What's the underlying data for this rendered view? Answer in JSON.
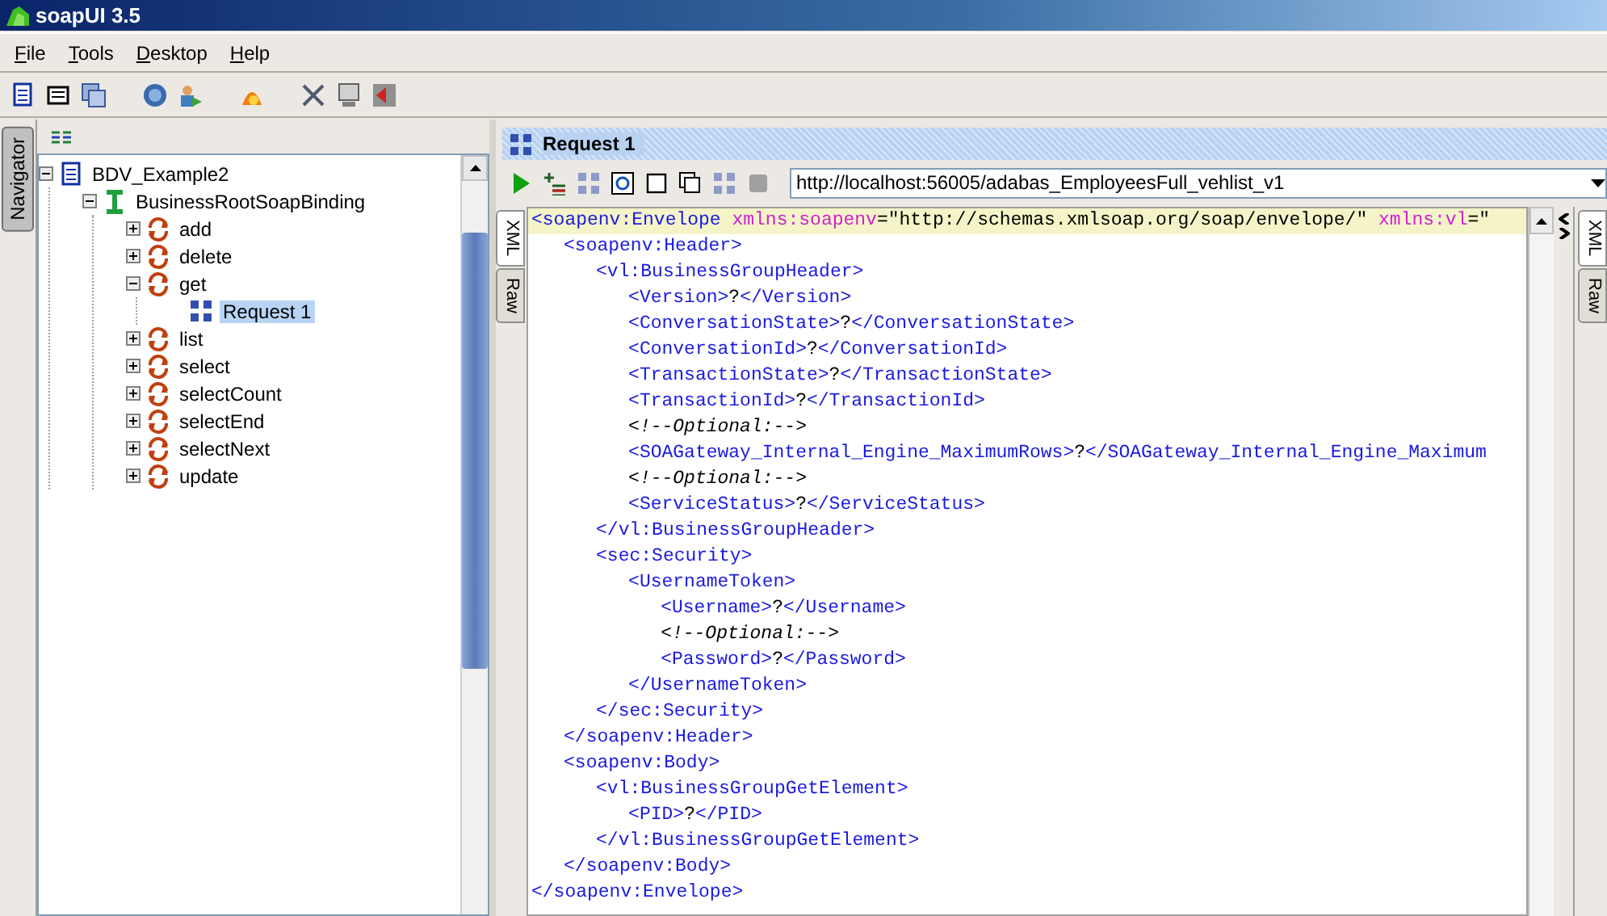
{
  "window": {
    "title": "soapUI 3.5"
  },
  "menu": [
    "File",
    "Tools",
    "Desktop",
    "Help"
  ],
  "navigator": {
    "tab": "Navigator",
    "tree": [
      {
        "label": "BDV_Example2",
        "kind": "project",
        "expanded": true,
        "selected": false,
        "children": [
          {
            "label": "BusinessRootSoapBinding",
            "kind": "interface",
            "expanded": true,
            "selected": false,
            "children": [
              {
                "label": "add",
                "kind": "operation",
                "expanded": false,
                "selected": false
              },
              {
                "label": "delete",
                "kind": "operation",
                "expanded": false,
                "selected": false
              },
              {
                "label": "get",
                "kind": "operation",
                "expanded": true,
                "selected": false,
                "children": [
                  {
                    "label": "Request 1",
                    "kind": "request",
                    "selected": true
                  }
                ]
              },
              {
                "label": "list",
                "kind": "operation",
                "expanded": false,
                "selected": false
              },
              {
                "label": "select",
                "kind": "operation",
                "expanded": false,
                "selected": false
              },
              {
                "label": "selectCount",
                "kind": "operation",
                "expanded": false,
                "selected": false
              },
              {
                "label": "selectEnd",
                "kind": "operation",
                "expanded": false,
                "selected": false
              },
              {
                "label": "selectNext",
                "kind": "operation",
                "expanded": false,
                "selected": false
              },
              {
                "label": "update",
                "kind": "operation",
                "expanded": false,
                "selected": false
              }
            ]
          }
        ]
      }
    ]
  },
  "request": {
    "title": "Request 1",
    "endpoint": "http://localhost:56005/adabas_EmployeesFull_vehlist_v1",
    "left_tabs": [
      {
        "label": "XML",
        "selected": true
      },
      {
        "label": "Raw",
        "selected": false
      }
    ],
    "right_tabs": [
      {
        "label": "XML",
        "selected": true
      },
      {
        "label": "Raw",
        "selected": false
      }
    ],
    "xml": [
      {
        "current": true,
        "segments": [
          {
            "kind": "tag",
            "text": "<soapenv:Envelope"
          },
          {
            "kind": "attr",
            "text": " xmlns:soapenv"
          },
          {
            "kind": "text",
            "text": "=\"http://schemas.xmlsoap.org/soap/envelope/\""
          },
          {
            "kind": "attr",
            "text": " xmlns:vl"
          },
          {
            "kind": "text",
            "text": "=\""
          }
        ],
        "children": [
          {
            "current": false,
            "segments": [
              {
                "kind": "tag",
                "text": "<soapenv:Header>"
              }
            ],
            "children": [
              {
                "current": false,
                "segments": [
                  {
                    "kind": "tag",
                    "text": "<vl:BusinessGroupHeader>"
                  }
                ],
                "children": [
                  {
                    "current": false,
                    "segments": [
                      {
                        "kind": "tag",
                        "text": "<Version>"
                      },
                      {
                        "kind": "text",
                        "text": "?"
                      },
                      {
                        "kind": "tag",
                        "text": "</Version>"
                      }
                    ]
                  },
                  {
                    "current": false,
                    "segments": [
                      {
                        "kind": "tag",
                        "text": "<ConversationState>"
                      },
                      {
                        "kind": "text",
                        "text": "?"
                      },
                      {
                        "kind": "tag",
                        "text": "</ConversationState>"
                      }
                    ]
                  },
                  {
                    "current": false,
                    "segments": [
                      {
                        "kind": "tag",
                        "text": "<ConversationId>"
                      },
                      {
                        "kind": "text",
                        "text": "?"
                      },
                      {
                        "kind": "tag",
                        "text": "</ConversationId>"
                      }
                    ]
                  },
                  {
                    "current": false,
                    "segments": [
                      {
                        "kind": "tag",
                        "text": "<TransactionState>"
                      },
                      {
                        "kind": "text",
                        "text": "?"
                      },
                      {
                        "kind": "tag",
                        "text": "</TransactionState>"
                      }
                    ]
                  },
                  {
                    "current": false,
                    "segments": [
                      {
                        "kind": "tag",
                        "text": "<TransactionId>"
                      },
                      {
                        "kind": "text",
                        "text": "?"
                      },
                      {
                        "kind": "tag",
                        "text": "</TransactionId>"
                      }
                    ]
                  },
                  {
                    "current": false,
                    "segments": [
                      {
                        "kind": "comment",
                        "text": "<!--Optional:-->"
                      }
                    ]
                  },
                  {
                    "current": false,
                    "segments": [
                      {
                        "kind": "tag",
                        "text": "<SOAGateway_Internal_Engine_MaximumRows>"
                      },
                      {
                        "kind": "text",
                        "text": "?"
                      },
                      {
                        "kind": "tag",
                        "text": "</SOAGateway_Internal_Engine_Maximum"
                      }
                    ]
                  },
                  {
                    "current": false,
                    "segments": [
                      {
                        "kind": "comment",
                        "text": "<!--Optional:-->"
                      }
                    ]
                  },
                  {
                    "current": false,
                    "segments": [
                      {
                        "kind": "tag",
                        "text": "<ServiceStatus>"
                      },
                      {
                        "kind": "text",
                        "text": "?"
                      },
                      {
                        "kind": "tag",
                        "text": "</ServiceStatus>"
                      }
                    ]
                  }
                ]
              },
              {
                "current": false,
                "segments": [
                  {
                    "kind": "tag",
                    "text": "</vl:BusinessGroupHeader>"
                  }
                ]
              },
              {
                "current": false,
                "segments": [
                  {
                    "kind": "tag",
                    "text": "<sec:Security>"
                  }
                ],
                "children": [
                  {
                    "current": false,
                    "segments": [
                      {
                        "kind": "tag",
                        "text": "<UsernameToken>"
                      }
                    ],
                    "children": [
                      {
                        "current": false,
                        "segments": [
                          {
                            "kind": "tag",
                            "text": "<Username>"
                          },
                          {
                            "kind": "text",
                            "text": "?"
                          },
                          {
                            "kind": "tag",
                            "text": "</Username>"
                          }
                        ]
                      },
                      {
                        "current": false,
                        "segments": [
                          {
                            "kind": "comment",
                            "text": "<!--Optional:-->"
                          }
                        ]
                      },
                      {
                        "current": false,
                        "segments": [
                          {
                            "kind": "tag",
                            "text": "<Password>"
                          },
                          {
                            "kind": "text",
                            "text": "?"
                          },
                          {
                            "kind": "tag",
                            "text": "</Password>"
                          }
                        ]
                      }
                    ]
                  },
                  {
                    "current": false,
                    "segments": [
                      {
                        "kind": "tag",
                        "text": "</UsernameToken>"
                      }
                    ]
                  }
                ]
              },
              {
                "current": false,
                "segments": [
                  {
                    "kind": "tag",
                    "text": "</sec:Security>"
                  }
                ]
              }
            ]
          },
          {
            "current": false,
            "segments": [
              {
                "kind": "tag",
                "text": "</soapenv:Header>"
              }
            ]
          },
          {
            "current": false,
            "segments": [
              {
                "kind": "tag",
                "text": "<soapenv:Body>"
              }
            ],
            "children": [
              {
                "current": false,
                "segments": [
                  {
                    "kind": "tag",
                    "text": "<vl:BusinessGroupGetElement>"
                  }
                ],
                "children": [
                  {
                    "current": false,
                    "segments": [
                      {
                        "kind": "tag",
                        "text": "<PID>"
                      },
                      {
                        "kind": "text",
                        "text": "?"
                      },
                      {
                        "kind": "tag",
                        "text": "</PID>"
                      }
                    ]
                  }
                ]
              },
              {
                "current": false,
                "segments": [
                  {
                    "kind": "tag",
                    "text": "</vl:BusinessGroupGetElement>"
                  }
                ]
              }
            ]
          },
          {
            "current": false,
            "segments": [
              {
                "kind": "tag",
                "text": "</soapenv:Body>"
              }
            ]
          }
        ]
      },
      {
        "current": false,
        "segments": [
          {
            "kind": "tag",
            "text": "</soapenv:Envelope>"
          }
        ]
      }
    ]
  }
}
